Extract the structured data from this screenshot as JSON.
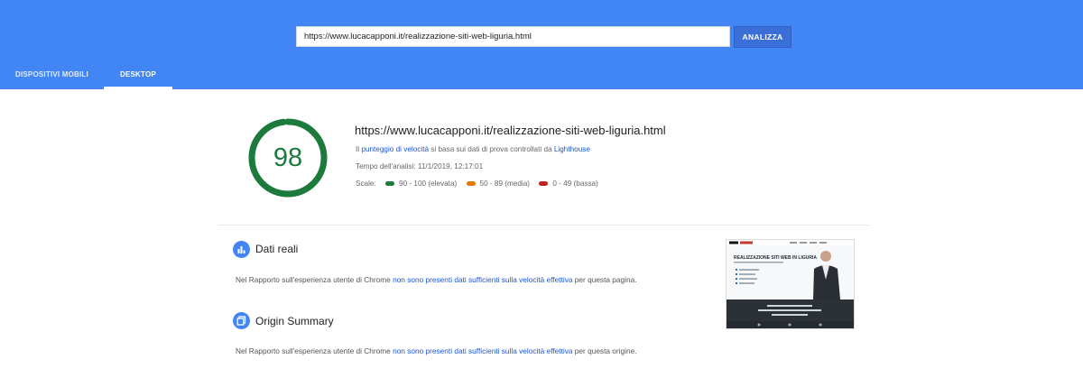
{
  "search": {
    "url": "https://www.lucacapponi.it/realizzazione-siti-web-liguria.html",
    "button_label": "ANALIZZA"
  },
  "tabs": [
    {
      "label": "DISPOSITIVI MOBILI",
      "active": false
    },
    {
      "label": "DESKTOP",
      "active": true
    }
  ],
  "summary": {
    "score": "98",
    "score_color": "#1c7a3d",
    "page_url": "https://www.lucacapponi.it/realizzazione-siti-web-liguria.html",
    "desc_prefix": "Il ",
    "desc_link1": "punteggio di velocità",
    "desc_middle": " si basa sui dati di prova controllati da ",
    "desc_link2": "Lighthouse",
    "analysis_time": "Tempo dell'analisi: 11/1/2019, 12:17:01",
    "scale_label": "Scale:",
    "scale": [
      {
        "label": "90 - 100 (elevata)",
        "color": "#1c7a3d"
      },
      {
        "label": "50 - 89 (media)",
        "color": "#e67700"
      },
      {
        "label": "0 - 49 (bassa)",
        "color": "#c5221f"
      }
    ]
  },
  "sections": [
    {
      "title": "Dati reali",
      "icon": "bar-chart-icon",
      "text_prefix": "Nel Rapporto sull'esperienza utente di Chrome ",
      "text_link": "non sono presenti dati sufficienti sulla velocità effettiva",
      "text_suffix": " per questa pagina."
    },
    {
      "title": "Origin Summary",
      "icon": "copy-pages-icon",
      "text_prefix": "Nel Rapporto sull'esperienza utente di Chrome ",
      "text_link": "non sono presenti dati sufficienti sulla velocità effettiva",
      "text_suffix": " per questa origine."
    }
  ],
  "thumbnail": {
    "headline": "REALIZZAZIONE SITI WEB IN LIGURIA",
    "colors": {
      "dark": "#2b3137",
      "brand_red": "#c0392b"
    }
  }
}
